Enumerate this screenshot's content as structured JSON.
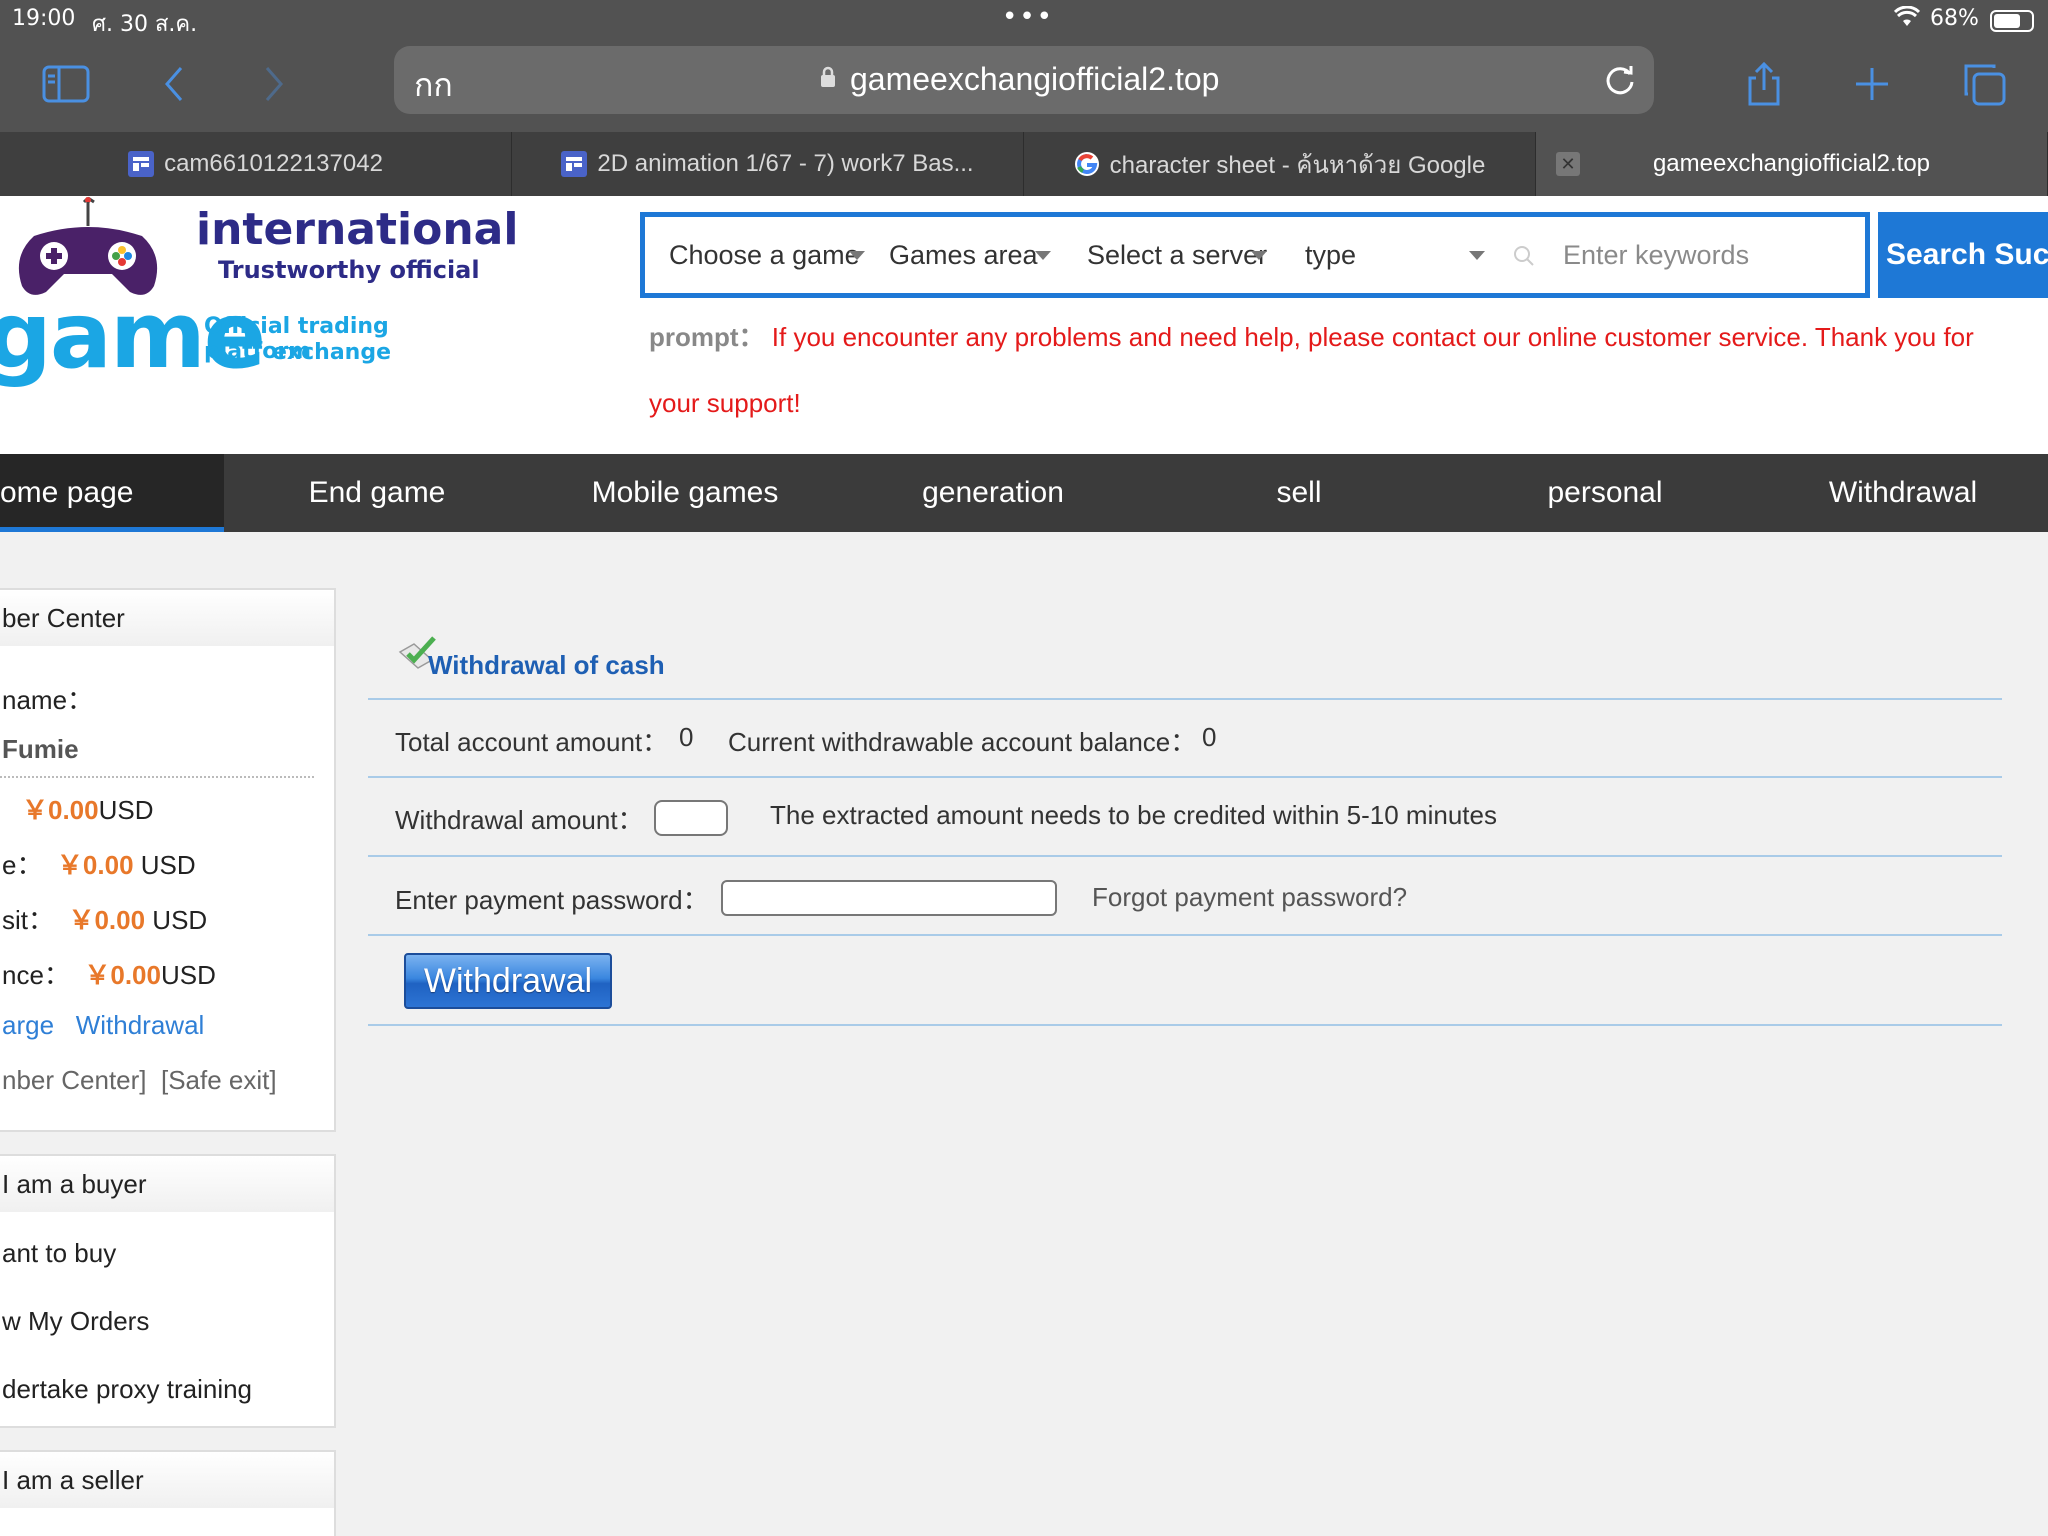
{
  "status_bar": {
    "time": "19:00",
    "date": "ศ. 30 ส.ค.",
    "battery": "68%"
  },
  "browser": {
    "url_prefix": "กก",
    "url": "gameexchangiofficial2.top",
    "tabs": [
      {
        "label": "cam6610122137042"
      },
      {
        "label": "2D animation 1/67 - 7) work7 Bas..."
      },
      {
        "label": "character sheet - ค้นหาด้วย Google"
      },
      {
        "label": "gameexchangiofficial2.top"
      }
    ]
  },
  "logo": {
    "line1": "international",
    "line2": "Trustworthy official",
    "line3": "game",
    "line4": "Official trading platform",
    "line5": "exchange"
  },
  "search": {
    "selects": [
      "Choose a game",
      "Games area",
      "Select a server",
      "type"
    ],
    "keyword_placeholder": "Enter keywords",
    "button": "Search  Suc"
  },
  "prompt": {
    "label": "prompt：",
    "text": "If you encounter any problems and need help, please contact our online customer service. Thank you for your support!"
  },
  "nav": {
    "items": [
      "ome page",
      "End game",
      "Mobile games",
      "generation",
      "sell",
      "personal",
      "Withdrawal"
    ]
  },
  "sidebar": {
    "member": {
      "title": "ber Center",
      "name_label": "name：",
      "name_value": "Fumie",
      "balance_value": "￥0.00",
      "balance_unit": "USD",
      "e_label": "e：",
      "e_value": "￥0.00",
      "e_unit": " USD",
      "deposit_label": "sit：",
      "deposit_value": "￥0.00",
      "deposit_unit": " USD",
      "ance_label": "nce：",
      "ance_value": "￥0.00",
      "ance_unit": "USD",
      "recharge": "arge",
      "withdrawal": "Withdrawal",
      "member_center": "nber Center]",
      "safe_exit": "[Safe exit]"
    },
    "buyer": {
      "title": " I am a buyer",
      "items": [
        "ant to buy",
        "w My Orders",
        "dertake proxy training"
      ]
    },
    "seller": {
      "title": " I am a seller"
    }
  },
  "withdraw": {
    "title": "Withdrawal of cash",
    "total_label": "Total account amount：",
    "total_value": "0",
    "current_label": "Current withdrawable account balance：",
    "current_value": "0",
    "amount_label": "Withdrawal amount：",
    "amount_note": "The extracted amount needs to be credited within 5-10 minutes",
    "password_label": "Enter payment password：",
    "forgot": "Forgot payment password?",
    "button": "Withdrawal"
  },
  "colors": {
    "accent_blue": "#1e78d6",
    "prompt_red": "#e41a1a",
    "amount_orange": "#e8782a",
    "nav_bg": "#3b3b3b"
  }
}
